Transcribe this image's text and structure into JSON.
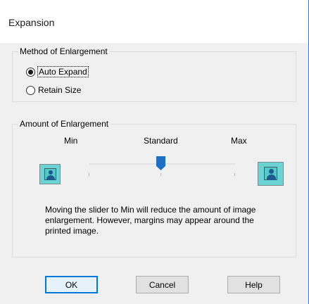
{
  "window": {
    "title": "Expansion"
  },
  "method_group": {
    "label": "Method of Enlargement",
    "options": [
      {
        "label": "Auto Expand",
        "checked": true
      },
      {
        "label": "Retain Size",
        "checked": false
      }
    ]
  },
  "amount_group": {
    "label": "Amount of Enlargement",
    "scale_labels": {
      "min": "Min",
      "standard": "Standard",
      "max": "Max"
    },
    "slider_level": "Standard",
    "min_icon": "image-small-icon",
    "max_icon": "image-large-icon",
    "description": "Moving the slider to Min will reduce the amount of image enlargement. However, margins may appear around the printed image."
  },
  "buttons": {
    "ok": "OK",
    "cancel": "Cancel",
    "help": "Help"
  },
  "colors": {
    "accent": "#0078d7",
    "slider_thumb": "#1f6fc5",
    "preview_fill": "#6bd3d3"
  }
}
